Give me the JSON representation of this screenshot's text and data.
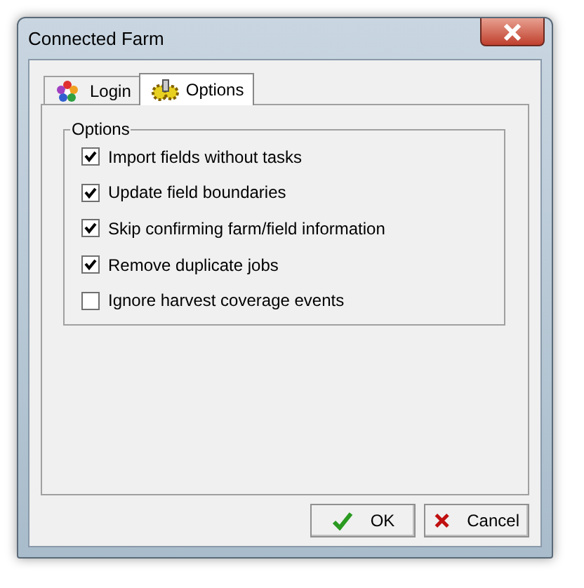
{
  "window": {
    "title": "Connected Farm"
  },
  "tabs": [
    {
      "label": "Login",
      "selected": false,
      "kind": "login"
    },
    {
      "label": "Options",
      "selected": true,
      "kind": "options"
    }
  ],
  "group": {
    "title": "Options"
  },
  "options": [
    {
      "label": "Import fields without tasks",
      "checked": true
    },
    {
      "label": "Update field boundaries",
      "checked": true
    },
    {
      "label": "Skip confirming farm/field information",
      "checked": true
    },
    {
      "label": "Remove duplicate jobs",
      "checked": true
    },
    {
      "label": "Ignore harvest coverage events",
      "checked": false
    }
  ],
  "buttons": [
    {
      "label": "OK",
      "kind": "ok"
    },
    {
      "label": "Cancel",
      "kind": "cancel"
    }
  ]
}
